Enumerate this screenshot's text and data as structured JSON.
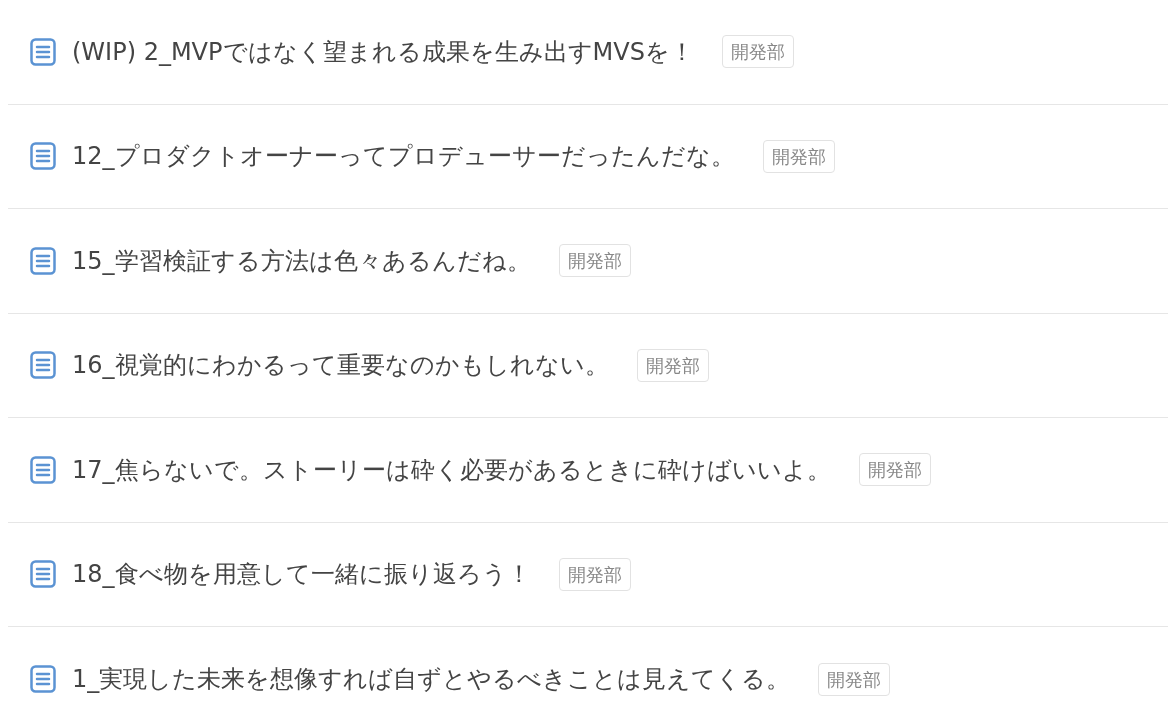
{
  "pages": [
    {
      "title": "(WIP) 2_MVPではなく望まれる成果を生み出すMVSを！",
      "tag": "開発部"
    },
    {
      "title": "12_プロダクトオーナーってプロデューサーだったんだな。",
      "tag": "開発部"
    },
    {
      "title": "15_学習検証する方法は色々あるんだね。",
      "tag": "開発部"
    },
    {
      "title": "16_視覚的にわかるって重要なのかもしれない。",
      "tag": "開発部"
    },
    {
      "title": "17_焦らないで。ストーリーは砕く必要があるときに砕けばいいよ。",
      "tag": "開発部"
    },
    {
      "title": "18_食べ物を用意して一緒に振り返ろう！",
      "tag": "開発部"
    },
    {
      "title": "1_実現した未来を想像すれば自ずとやるべきことは見えてくる。",
      "tag": "開発部"
    }
  ]
}
